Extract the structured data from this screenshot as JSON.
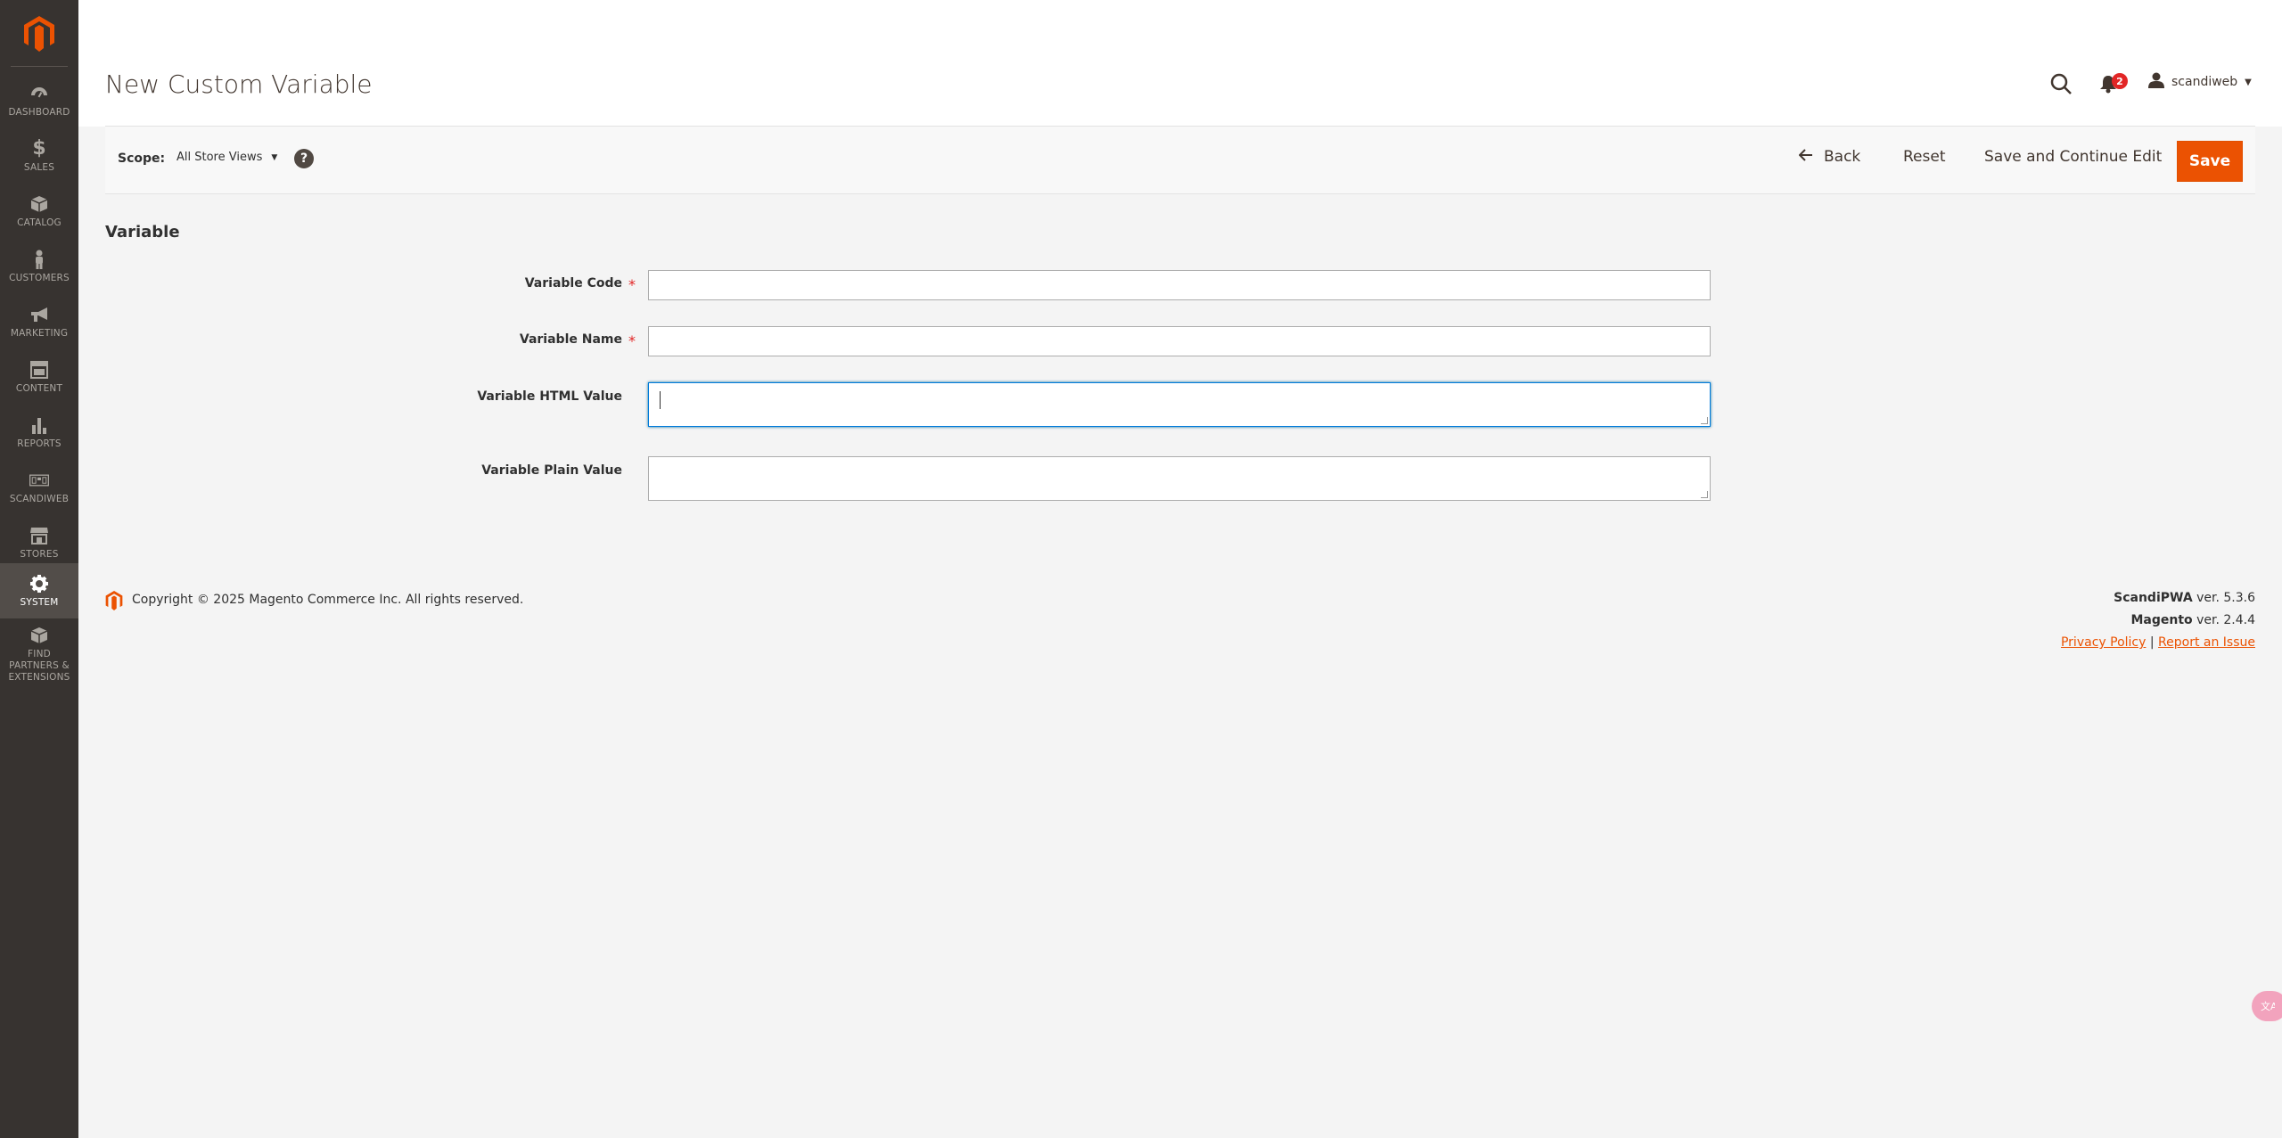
{
  "sidebar": {
    "items": [
      {
        "label": "Dashboard",
        "icon": "dashboard-icon"
      },
      {
        "label": "Sales",
        "icon": "dollar-icon"
      },
      {
        "label": "Catalog",
        "icon": "box-icon"
      },
      {
        "label": "Customers",
        "icon": "person-icon"
      },
      {
        "label": "Marketing",
        "icon": "megaphone-icon"
      },
      {
        "label": "Content",
        "icon": "layout-icon"
      },
      {
        "label": "Reports",
        "icon": "bar-chart-icon"
      },
      {
        "label": "Scandiweb",
        "icon": "grid-icon"
      },
      {
        "label": "Stores",
        "icon": "store-icon"
      },
      {
        "label": "System",
        "icon": "gear-icon"
      },
      {
        "label": "Find Partners & Extensions",
        "icon": "cube-icon"
      }
    ],
    "active": "System"
  },
  "header": {
    "title": "New Custom Variable",
    "notifications_count": "2",
    "user_name": "scandiweb"
  },
  "actions": {
    "scope_label": "Scope:",
    "scope_value": "All Store Views",
    "help": "?",
    "back_label": "Back",
    "reset_label": "Reset",
    "save_continue_label": "Save and Continue Edit",
    "save_label": "Save"
  },
  "form": {
    "section_title": "Variable",
    "fields": [
      {
        "label": "Variable Code",
        "required": true,
        "value": ""
      },
      {
        "label": "Variable Name",
        "required": true,
        "value": ""
      },
      {
        "label": "Variable HTML Value",
        "required": false,
        "value": ""
      },
      {
        "label": "Variable Plain Value",
        "required": false,
        "value": ""
      }
    ]
  },
  "footer": {
    "copyright": "Copyright © 2025 Magento Commerce Inc. All rights reserved.",
    "scandipwa_name": "ScandiPWA",
    "scandipwa_ver": " ver. 5.3.6",
    "magento_name": "Magento",
    "magento_ver": " ver. 2.4.4",
    "privacy_policy": "Privacy Policy",
    "separator": "|",
    "report_issue": "Report an Issue"
  },
  "colors": {
    "accent": "#eb5202",
    "sidebar_bg": "#373330",
    "focus": "#007bdb"
  }
}
